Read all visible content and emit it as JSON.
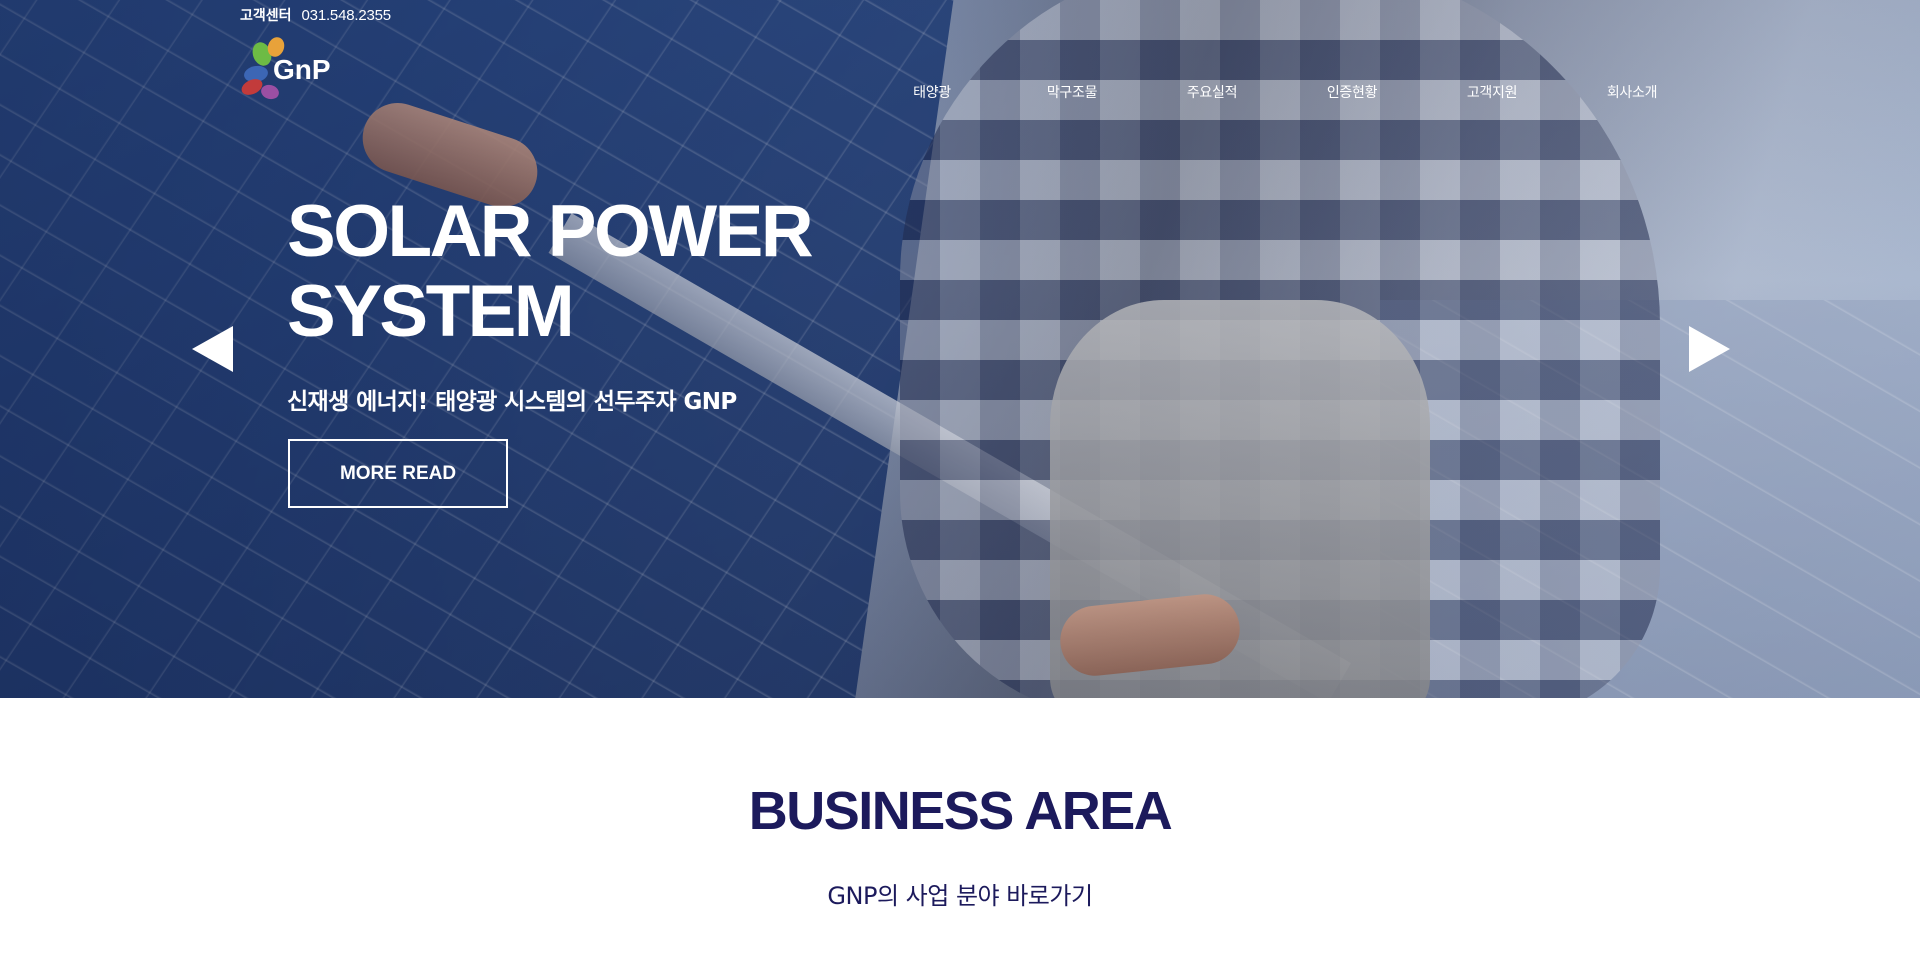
{
  "topbar": {
    "customer_center_label": "고객센터",
    "customer_center_phone": "031.548.2355"
  },
  "logo": {
    "text": "GnP"
  },
  "nav": {
    "items": [
      {
        "label": "태양광"
      },
      {
        "label": "막구조물"
      },
      {
        "label": "주요실적"
      },
      {
        "label": "인증현황"
      },
      {
        "label": "고객지원"
      },
      {
        "label": "회사소개"
      }
    ]
  },
  "hero": {
    "title_line1": "SOLAR POWER",
    "title_line2": "SYSTEM",
    "subtitle": "신재생 에너지! 태양광 시스템의 선두주자 GNP",
    "button_label": "MORE READ",
    "prev_icon": "triangle-left-icon",
    "next_icon": "triangle-right-icon"
  },
  "business": {
    "title": "BUSINESS AREA",
    "subtitle": "GNP의 사업 분야 바로가기"
  },
  "colors": {
    "heading_navy": "#1c1a5c",
    "white": "#ffffff"
  }
}
